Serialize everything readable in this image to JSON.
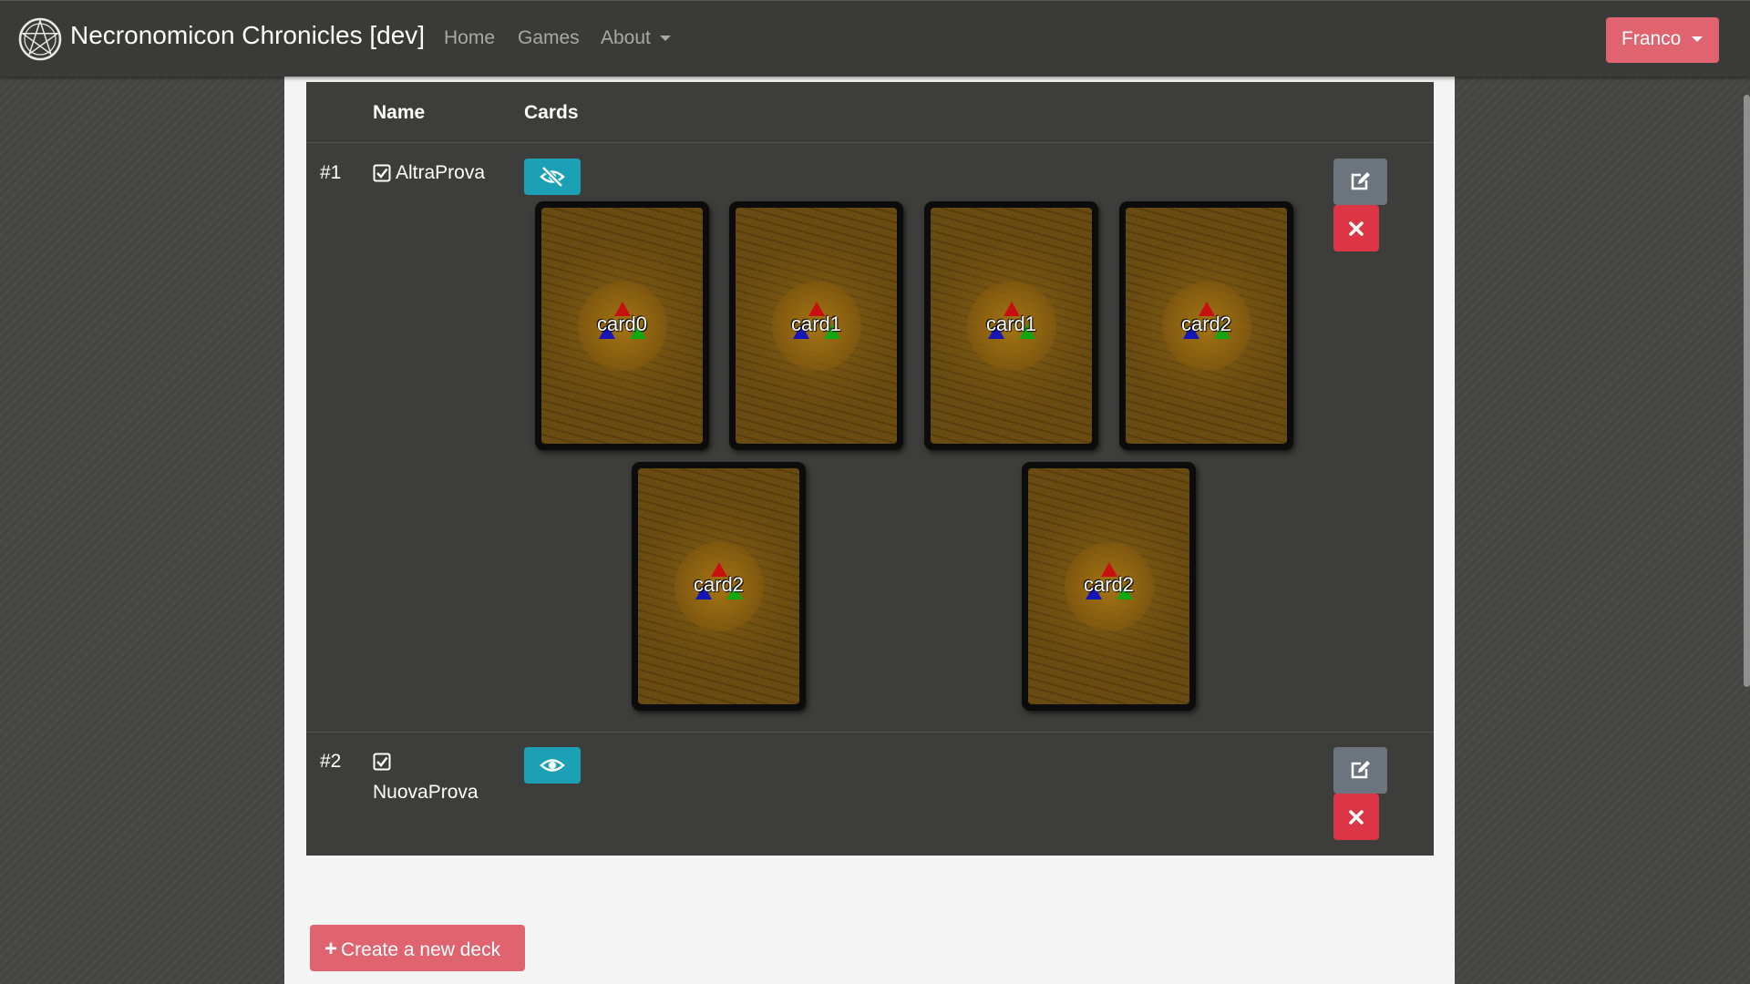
{
  "navbar": {
    "brand": "Necronomicon Chronicles [dev]",
    "brand_icon": "pentagram-logo-icon",
    "links": [
      {
        "label": "Home"
      },
      {
        "label": "Games"
      },
      {
        "label": "About"
      }
    ],
    "user_menu": "Franco"
  },
  "table": {
    "headers": {
      "name": "Name",
      "cards": "Cards"
    },
    "rows": [
      {
        "num": "#1",
        "name": "AltraProva",
        "cards_visible": true,
        "toggle_icon": "eye-slash-icon",
        "cards": [
          "card0",
          "card1",
          "card1",
          "card2",
          "card2",
          "card2"
        ]
      },
      {
        "num": "#2",
        "name": "NuovaProva",
        "cards_visible": false,
        "toggle_icon": "eye-icon",
        "cards": []
      }
    ]
  },
  "create_button": "Create a new deck",
  "colors": {
    "primary": "#e06470",
    "info": "#1ba0b6",
    "secondary": "#6c757d",
    "danger": "#dc3545",
    "navbar": "#3a3a38",
    "table_bg": "#3d3d3b"
  }
}
